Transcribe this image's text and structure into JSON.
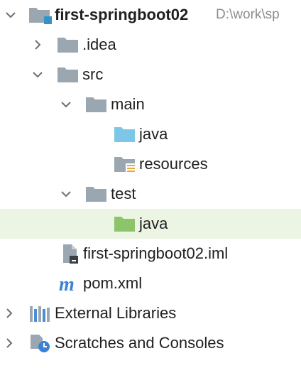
{
  "project": {
    "name": "first-springboot02",
    "path": "D:\\work\\sp",
    "icon": "project-module-icon",
    "expanded": true
  },
  "nodes": {
    "idea": {
      "label": ".idea",
      "icon": "folder-icon",
      "expanded": false
    },
    "src": {
      "label": "src",
      "icon": "folder-icon",
      "expanded": true
    },
    "main": {
      "label": "main",
      "icon": "folder-icon",
      "expanded": true
    },
    "main_java": {
      "label": "java",
      "icon": "source-root-folder-icon"
    },
    "resources": {
      "label": "resources",
      "icon": "resources-folder-icon"
    },
    "test": {
      "label": "test",
      "icon": "folder-icon",
      "expanded": true
    },
    "test_java": {
      "label": "java",
      "icon": "test-root-folder-icon",
      "selected": true
    },
    "iml": {
      "label": "first-springboot02.iml",
      "icon": "iml-file-icon"
    },
    "pom": {
      "label": "pom.xml",
      "icon": "maven-icon"
    },
    "libraries": {
      "label": "External Libraries",
      "icon": "libraries-icon",
      "expanded": false
    },
    "scratches": {
      "label": "Scratches and Consoles",
      "icon": "scratches-icon",
      "expanded": false
    }
  },
  "colors": {
    "selected_row": "#ecf5e3",
    "folder": "#9aa7b0",
    "source_folder": "#7cc7e7",
    "test_folder": "#8cc46a",
    "maven": "#3b82d6"
  }
}
